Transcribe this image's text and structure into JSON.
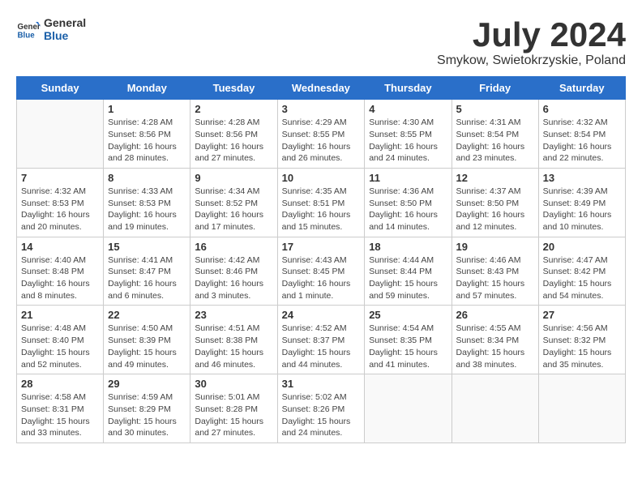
{
  "logo": {
    "general": "General",
    "blue": "Blue"
  },
  "title": {
    "month_year": "July 2024",
    "location": "Smykow, Swietokrzyskie, Poland"
  },
  "headers": [
    "Sunday",
    "Monday",
    "Tuesday",
    "Wednesday",
    "Thursday",
    "Friday",
    "Saturday"
  ],
  "weeks": [
    [
      {
        "day": "",
        "content": ""
      },
      {
        "day": "1",
        "content": "Sunrise: 4:28 AM\nSunset: 8:56 PM\nDaylight: 16 hours\nand 28 minutes."
      },
      {
        "day": "2",
        "content": "Sunrise: 4:28 AM\nSunset: 8:56 PM\nDaylight: 16 hours\nand 27 minutes."
      },
      {
        "day": "3",
        "content": "Sunrise: 4:29 AM\nSunset: 8:55 PM\nDaylight: 16 hours\nand 26 minutes."
      },
      {
        "day": "4",
        "content": "Sunrise: 4:30 AM\nSunset: 8:55 PM\nDaylight: 16 hours\nand 24 minutes."
      },
      {
        "day": "5",
        "content": "Sunrise: 4:31 AM\nSunset: 8:54 PM\nDaylight: 16 hours\nand 23 minutes."
      },
      {
        "day": "6",
        "content": "Sunrise: 4:32 AM\nSunset: 8:54 PM\nDaylight: 16 hours\nand 22 minutes."
      }
    ],
    [
      {
        "day": "7",
        "content": "Sunrise: 4:32 AM\nSunset: 8:53 PM\nDaylight: 16 hours\nand 20 minutes."
      },
      {
        "day": "8",
        "content": "Sunrise: 4:33 AM\nSunset: 8:53 PM\nDaylight: 16 hours\nand 19 minutes."
      },
      {
        "day": "9",
        "content": "Sunrise: 4:34 AM\nSunset: 8:52 PM\nDaylight: 16 hours\nand 17 minutes."
      },
      {
        "day": "10",
        "content": "Sunrise: 4:35 AM\nSunset: 8:51 PM\nDaylight: 16 hours\nand 15 minutes."
      },
      {
        "day": "11",
        "content": "Sunrise: 4:36 AM\nSunset: 8:50 PM\nDaylight: 16 hours\nand 14 minutes."
      },
      {
        "day": "12",
        "content": "Sunrise: 4:37 AM\nSunset: 8:50 PM\nDaylight: 16 hours\nand 12 minutes."
      },
      {
        "day": "13",
        "content": "Sunrise: 4:39 AM\nSunset: 8:49 PM\nDaylight: 16 hours\nand 10 minutes."
      }
    ],
    [
      {
        "day": "14",
        "content": "Sunrise: 4:40 AM\nSunset: 8:48 PM\nDaylight: 16 hours\nand 8 minutes."
      },
      {
        "day": "15",
        "content": "Sunrise: 4:41 AM\nSunset: 8:47 PM\nDaylight: 16 hours\nand 6 minutes."
      },
      {
        "day": "16",
        "content": "Sunrise: 4:42 AM\nSunset: 8:46 PM\nDaylight: 16 hours\nand 3 minutes."
      },
      {
        "day": "17",
        "content": "Sunrise: 4:43 AM\nSunset: 8:45 PM\nDaylight: 16 hours\nand 1 minute."
      },
      {
        "day": "18",
        "content": "Sunrise: 4:44 AM\nSunset: 8:44 PM\nDaylight: 15 hours\nand 59 minutes."
      },
      {
        "day": "19",
        "content": "Sunrise: 4:46 AM\nSunset: 8:43 PM\nDaylight: 15 hours\nand 57 minutes."
      },
      {
        "day": "20",
        "content": "Sunrise: 4:47 AM\nSunset: 8:42 PM\nDaylight: 15 hours\nand 54 minutes."
      }
    ],
    [
      {
        "day": "21",
        "content": "Sunrise: 4:48 AM\nSunset: 8:40 PM\nDaylight: 15 hours\nand 52 minutes."
      },
      {
        "day": "22",
        "content": "Sunrise: 4:50 AM\nSunset: 8:39 PM\nDaylight: 15 hours\nand 49 minutes."
      },
      {
        "day": "23",
        "content": "Sunrise: 4:51 AM\nSunset: 8:38 PM\nDaylight: 15 hours\nand 46 minutes."
      },
      {
        "day": "24",
        "content": "Sunrise: 4:52 AM\nSunset: 8:37 PM\nDaylight: 15 hours\nand 44 minutes."
      },
      {
        "day": "25",
        "content": "Sunrise: 4:54 AM\nSunset: 8:35 PM\nDaylight: 15 hours\nand 41 minutes."
      },
      {
        "day": "26",
        "content": "Sunrise: 4:55 AM\nSunset: 8:34 PM\nDaylight: 15 hours\nand 38 minutes."
      },
      {
        "day": "27",
        "content": "Sunrise: 4:56 AM\nSunset: 8:32 PM\nDaylight: 15 hours\nand 35 minutes."
      }
    ],
    [
      {
        "day": "28",
        "content": "Sunrise: 4:58 AM\nSunset: 8:31 PM\nDaylight: 15 hours\nand 33 minutes."
      },
      {
        "day": "29",
        "content": "Sunrise: 4:59 AM\nSunset: 8:29 PM\nDaylight: 15 hours\nand 30 minutes."
      },
      {
        "day": "30",
        "content": "Sunrise: 5:01 AM\nSunset: 8:28 PM\nDaylight: 15 hours\nand 27 minutes."
      },
      {
        "day": "31",
        "content": "Sunrise: 5:02 AM\nSunset: 8:26 PM\nDaylight: 15 hours\nand 24 minutes."
      },
      {
        "day": "",
        "content": ""
      },
      {
        "day": "",
        "content": ""
      },
      {
        "day": "",
        "content": ""
      }
    ]
  ]
}
